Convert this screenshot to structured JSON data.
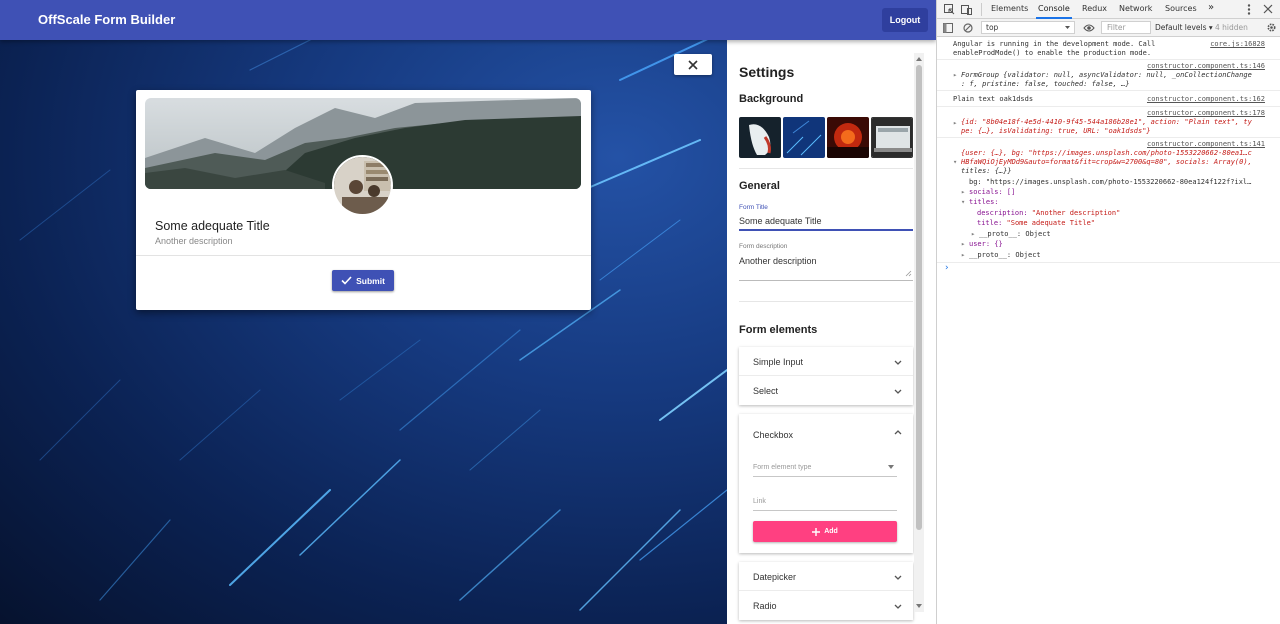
{
  "app": {
    "title": "OffScale Form Builder",
    "logout_label": "Logout"
  },
  "form": {
    "title": "Some adequate Title",
    "description": "Another description",
    "submit_label": "Submit"
  },
  "settings": {
    "heading": "Settings",
    "background_heading": "Background",
    "general_heading": "General",
    "form_title_label": "Form Title",
    "form_title_value": "Some adequate Title",
    "form_description_label": "Form description",
    "form_description_value": "Another description",
    "form_elements_heading": "Form elements",
    "elements": {
      "simple_input": "Simple Input",
      "select": "Select",
      "checkbox": "Checkbox",
      "datepicker": "Datepicker",
      "radio": "Radio"
    },
    "checkbox_panel": {
      "type_placeholder": "Form element type",
      "link_placeholder": "Link",
      "add_label": "Add"
    }
  },
  "devtools": {
    "tabs": [
      "Elements",
      "Console",
      "Redux",
      "Network",
      "Sources"
    ],
    "active_tab": "Console",
    "context": "top",
    "filter_placeholder": "Filter",
    "levels": "Default levels",
    "hidden_count": "4 hidden",
    "messages": {
      "m1_line1": "Angular is running in the development mode. Call",
      "m1_line2": "enableProdMode() to enable the production mode.",
      "m1_src": "core.js:16828",
      "m2_src": "constructor.component.ts:146",
      "m2_line1": "FormGroup {validator: null, asyncValidator: null, _onCollectionChange",
      "m2_line2": ": f, pristine: false, touched: false, …}",
      "m3_text": "Plain text oak1dsds",
      "m3_src": "constructor.component.ts:162",
      "m4_src": "constructor.component.ts:178",
      "m4_line1": "{id: \"8b04e18f-4e5d-4410-9f45-544a186b28e1\", action: \"Plain text\", ty",
      "m4_line2": "pe: {…}, isValidating: true, URL: \"oak1dsds\"}",
      "m5_src": "constructor.component.ts:141",
      "m5_line1": "{user: {…}, bg: \"https://images.unsplash.com/photo-1553220662-80ea1…c",
      "m5_line2": "HBfaWQiOjEyMDd9&auto=format&fit=crop&w=2700&q=80\", socials: Array(0),",
      "m5_line3": "titles: {…}}",
      "m5_bg": "bg: \"https://images.unsplash.com/photo-1553220662-80ea124f122f?ixl…",
      "m5_socials": "socials: []",
      "m5_titles": "titles:",
      "m5_desc_key": "description: ",
      "m5_desc_val": "\"Another description\"",
      "m5_title_key": "title: ",
      "m5_title_val": "\"Some adequate Title\"",
      "m5_proto1": "__proto__: Object",
      "m5_user": "user: {}",
      "m5_proto2": "__proto__: Object"
    }
  },
  "colors": {
    "primary": "#3f51b5",
    "accent": "#ff4081",
    "header_bg": "#3f51b5"
  }
}
